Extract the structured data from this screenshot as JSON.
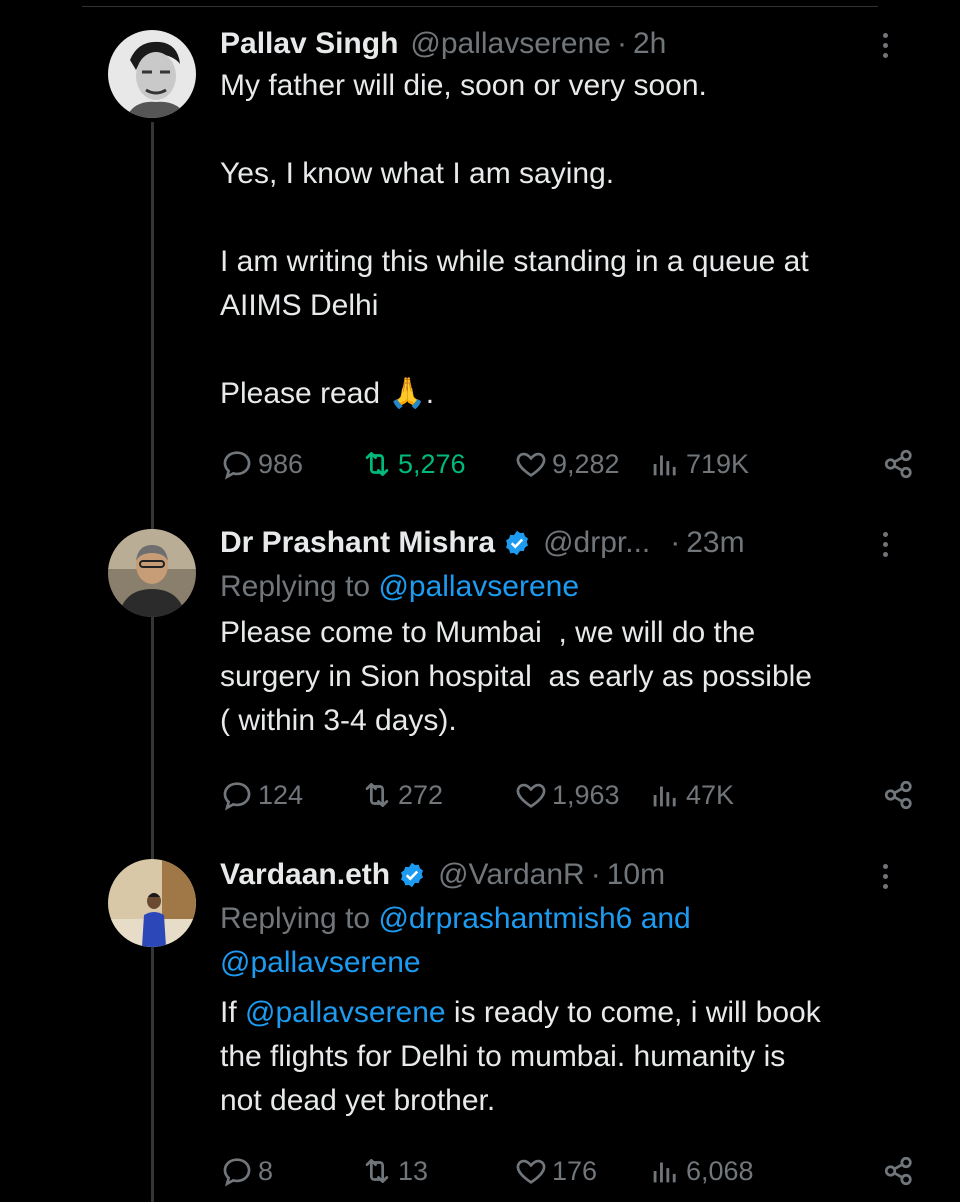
{
  "colors": {
    "background": "#000000",
    "text": "#e7e9ea",
    "muted": "#71767b",
    "link": "#1d9bf0",
    "retweet_active": "#00ba7c",
    "verified": "#1d9bf0"
  },
  "tweets": [
    {
      "name": "Pallav Singh",
      "handle": "@pallavserene",
      "time": "2h",
      "body_lines": [
        "My father will die, soon or very soon.",
        "Yes, I know what I am saying.",
        "I am writing this while standing in a queue at AIIMS Delhi",
        "Please read 🙏."
      ],
      "replies": "986",
      "retweets": "5,276",
      "likes": "9,282",
      "views": "719K"
    },
    {
      "name": "Dr Prashant Mishra",
      "verified": true,
      "handle": "@drpr...",
      "time": "23m",
      "reply_prefix": "Replying to",
      "reply_mention": "@pallavserene",
      "body": "Please come to Mumbai  , we will do the surgery in Sion hospital  as early as possible ( within 3-4 days).",
      "replies": "124",
      "retweets": "272",
      "likes": "1,963",
      "views": "47K"
    },
    {
      "name": "Vardaan.eth",
      "verified": true,
      "handle": "@VardanR",
      "time": "10m",
      "reply_prefix": "Replying to",
      "reply_mention_1": "@drprashantmish6",
      "reply_and": "and",
      "reply_mention_2": "@pallavserene",
      "body_pre": "If ",
      "body_mention": "@pallavserene",
      "body_post": " is ready to come, i will book the flights for Delhi to mumbai. humanity is not dead yet brother.",
      "replies": "8",
      "retweets": "13",
      "likes": "176",
      "views": "6,068"
    }
  ],
  "icons": [
    "reply-icon",
    "retweet-icon",
    "like-icon",
    "views-icon",
    "share-icon",
    "more-icon",
    "verified-icon"
  ]
}
